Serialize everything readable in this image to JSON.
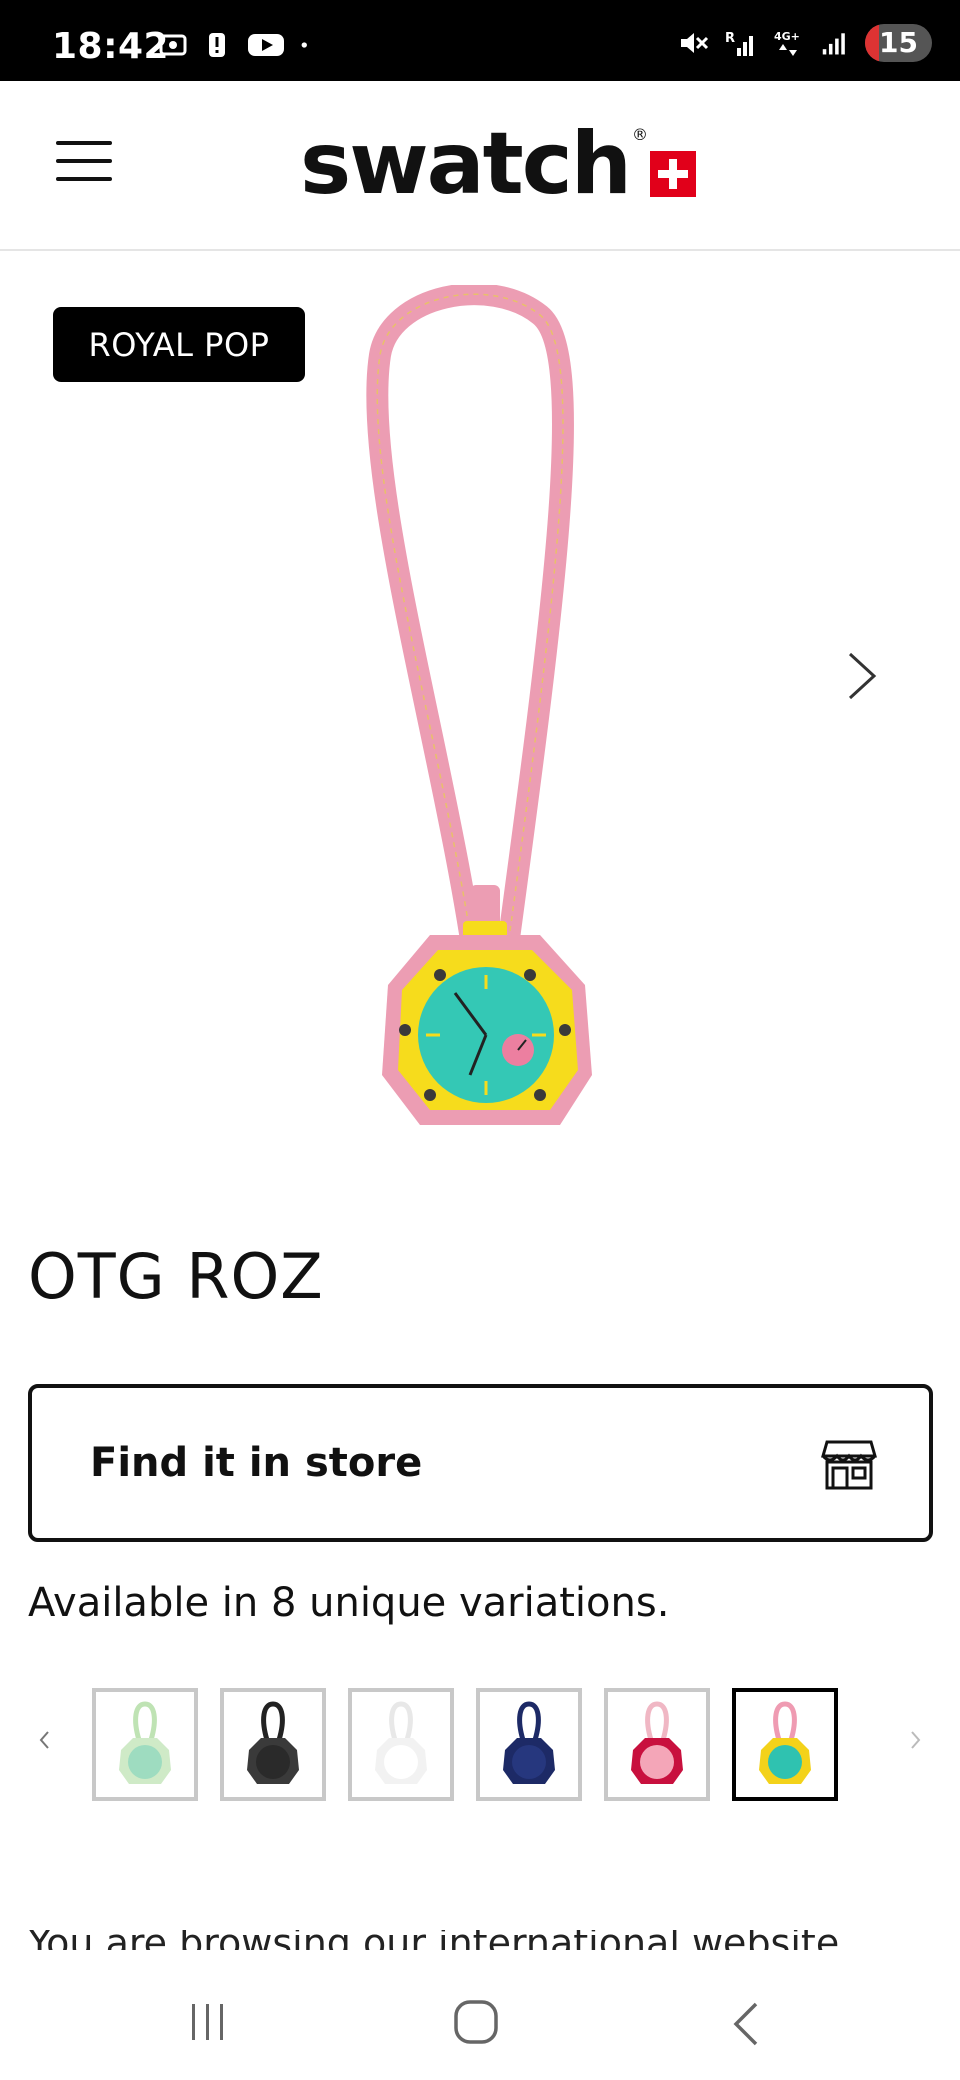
{
  "status_bar": {
    "time": "18:42",
    "battery": "15"
  },
  "header": {
    "logo_text": "swatch",
    "logo_reg": "®"
  },
  "product": {
    "badge": "ROYAL POP",
    "title": "OTG ROZ",
    "find_store_label": "Find it in store",
    "variations_text": "Available in 8 unique variations.",
    "thumbnails": [
      {
        "case": "#cfeac7",
        "dial": "#9edcc0",
        "strap": "#bfe3b4"
      },
      {
        "case": "#3a3a3a",
        "dial": "#2a2a2a",
        "strap": "#222222"
      },
      {
        "case": "#f2f2f2",
        "dial": "#ffffff",
        "strap": "#e8e8e8"
      },
      {
        "case": "#1d2a66",
        "dial": "#26377e",
        "strap": "#1d2a66"
      },
      {
        "case": "#c8103e",
        "dial": "#f4a6b8",
        "strap": "#f0b7c4"
      },
      {
        "case": "#f3d21a",
        "dial": "#2fc2b0",
        "strap": "#ef9bb2"
      }
    ]
  },
  "footer": {
    "note": "You are browsing our international website"
  },
  "colors": {
    "strap_pink": "#ec9db3",
    "case_yellow": "#f6dc1c",
    "dial_teal": "#34c8b5",
    "swatch_red": "#e1001a"
  }
}
